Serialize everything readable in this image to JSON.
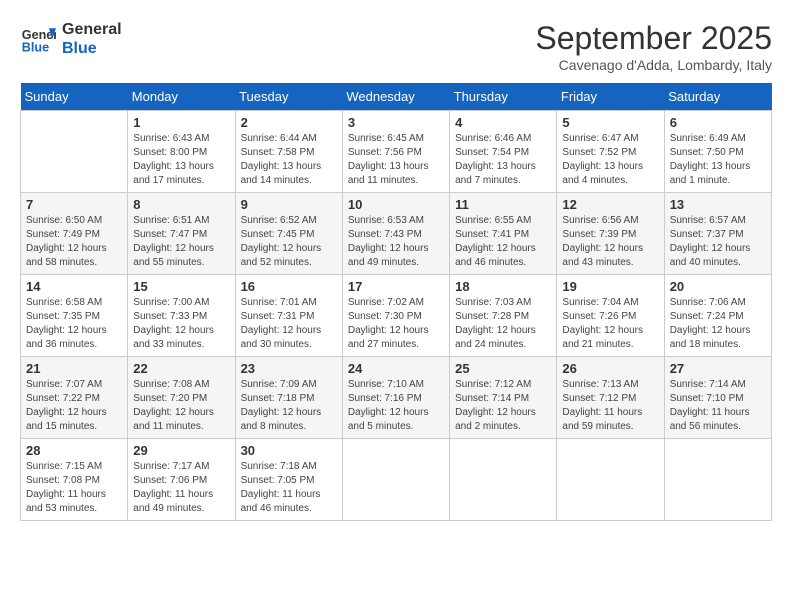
{
  "header": {
    "logo_line1": "General",
    "logo_line2": "Blue",
    "title": "September 2025",
    "subtitle": "Cavenago d'Adda, Lombardy, Italy"
  },
  "weekdays": [
    "Sunday",
    "Monday",
    "Tuesday",
    "Wednesday",
    "Thursday",
    "Friday",
    "Saturday"
  ],
  "weeks": [
    [
      {
        "day": "",
        "sunrise": "",
        "sunset": "",
        "daylight": ""
      },
      {
        "day": "1",
        "sunrise": "Sunrise: 6:43 AM",
        "sunset": "Sunset: 8:00 PM",
        "daylight": "Daylight: 13 hours and 17 minutes."
      },
      {
        "day": "2",
        "sunrise": "Sunrise: 6:44 AM",
        "sunset": "Sunset: 7:58 PM",
        "daylight": "Daylight: 13 hours and 14 minutes."
      },
      {
        "day": "3",
        "sunrise": "Sunrise: 6:45 AM",
        "sunset": "Sunset: 7:56 PM",
        "daylight": "Daylight: 13 hours and 11 minutes."
      },
      {
        "day": "4",
        "sunrise": "Sunrise: 6:46 AM",
        "sunset": "Sunset: 7:54 PM",
        "daylight": "Daylight: 13 hours and 7 minutes."
      },
      {
        "day": "5",
        "sunrise": "Sunrise: 6:47 AM",
        "sunset": "Sunset: 7:52 PM",
        "daylight": "Daylight: 13 hours and 4 minutes."
      },
      {
        "day": "6",
        "sunrise": "Sunrise: 6:49 AM",
        "sunset": "Sunset: 7:50 PM",
        "daylight": "Daylight: 13 hours and 1 minute."
      }
    ],
    [
      {
        "day": "7",
        "sunrise": "Sunrise: 6:50 AM",
        "sunset": "Sunset: 7:49 PM",
        "daylight": "Daylight: 12 hours and 58 minutes."
      },
      {
        "day": "8",
        "sunrise": "Sunrise: 6:51 AM",
        "sunset": "Sunset: 7:47 PM",
        "daylight": "Daylight: 12 hours and 55 minutes."
      },
      {
        "day": "9",
        "sunrise": "Sunrise: 6:52 AM",
        "sunset": "Sunset: 7:45 PM",
        "daylight": "Daylight: 12 hours and 52 minutes."
      },
      {
        "day": "10",
        "sunrise": "Sunrise: 6:53 AM",
        "sunset": "Sunset: 7:43 PM",
        "daylight": "Daylight: 12 hours and 49 minutes."
      },
      {
        "day": "11",
        "sunrise": "Sunrise: 6:55 AM",
        "sunset": "Sunset: 7:41 PM",
        "daylight": "Daylight: 12 hours and 46 minutes."
      },
      {
        "day": "12",
        "sunrise": "Sunrise: 6:56 AM",
        "sunset": "Sunset: 7:39 PM",
        "daylight": "Daylight: 12 hours and 43 minutes."
      },
      {
        "day": "13",
        "sunrise": "Sunrise: 6:57 AM",
        "sunset": "Sunset: 7:37 PM",
        "daylight": "Daylight: 12 hours and 40 minutes."
      }
    ],
    [
      {
        "day": "14",
        "sunrise": "Sunrise: 6:58 AM",
        "sunset": "Sunset: 7:35 PM",
        "daylight": "Daylight: 12 hours and 36 minutes."
      },
      {
        "day": "15",
        "sunrise": "Sunrise: 7:00 AM",
        "sunset": "Sunset: 7:33 PM",
        "daylight": "Daylight: 12 hours and 33 minutes."
      },
      {
        "day": "16",
        "sunrise": "Sunrise: 7:01 AM",
        "sunset": "Sunset: 7:31 PM",
        "daylight": "Daylight: 12 hours and 30 minutes."
      },
      {
        "day": "17",
        "sunrise": "Sunrise: 7:02 AM",
        "sunset": "Sunset: 7:30 PM",
        "daylight": "Daylight: 12 hours and 27 minutes."
      },
      {
        "day": "18",
        "sunrise": "Sunrise: 7:03 AM",
        "sunset": "Sunset: 7:28 PM",
        "daylight": "Daylight: 12 hours and 24 minutes."
      },
      {
        "day": "19",
        "sunrise": "Sunrise: 7:04 AM",
        "sunset": "Sunset: 7:26 PM",
        "daylight": "Daylight: 12 hours and 21 minutes."
      },
      {
        "day": "20",
        "sunrise": "Sunrise: 7:06 AM",
        "sunset": "Sunset: 7:24 PM",
        "daylight": "Daylight: 12 hours and 18 minutes."
      }
    ],
    [
      {
        "day": "21",
        "sunrise": "Sunrise: 7:07 AM",
        "sunset": "Sunset: 7:22 PM",
        "daylight": "Daylight: 12 hours and 15 minutes."
      },
      {
        "day": "22",
        "sunrise": "Sunrise: 7:08 AM",
        "sunset": "Sunset: 7:20 PM",
        "daylight": "Daylight: 12 hours and 11 minutes."
      },
      {
        "day": "23",
        "sunrise": "Sunrise: 7:09 AM",
        "sunset": "Sunset: 7:18 PM",
        "daylight": "Daylight: 12 hours and 8 minutes."
      },
      {
        "day": "24",
        "sunrise": "Sunrise: 7:10 AM",
        "sunset": "Sunset: 7:16 PM",
        "daylight": "Daylight: 12 hours and 5 minutes."
      },
      {
        "day": "25",
        "sunrise": "Sunrise: 7:12 AM",
        "sunset": "Sunset: 7:14 PM",
        "daylight": "Daylight: 12 hours and 2 minutes."
      },
      {
        "day": "26",
        "sunrise": "Sunrise: 7:13 AM",
        "sunset": "Sunset: 7:12 PM",
        "daylight": "Daylight: 11 hours and 59 minutes."
      },
      {
        "day": "27",
        "sunrise": "Sunrise: 7:14 AM",
        "sunset": "Sunset: 7:10 PM",
        "daylight": "Daylight: 11 hours and 56 minutes."
      }
    ],
    [
      {
        "day": "28",
        "sunrise": "Sunrise: 7:15 AM",
        "sunset": "Sunset: 7:08 PM",
        "daylight": "Daylight: 11 hours and 53 minutes."
      },
      {
        "day": "29",
        "sunrise": "Sunrise: 7:17 AM",
        "sunset": "Sunset: 7:06 PM",
        "daylight": "Daylight: 11 hours and 49 minutes."
      },
      {
        "day": "30",
        "sunrise": "Sunrise: 7:18 AM",
        "sunset": "Sunset: 7:05 PM",
        "daylight": "Daylight: 11 hours and 46 minutes."
      },
      {
        "day": "",
        "sunrise": "",
        "sunset": "",
        "daylight": ""
      },
      {
        "day": "",
        "sunrise": "",
        "sunset": "",
        "daylight": ""
      },
      {
        "day": "",
        "sunrise": "",
        "sunset": "",
        "daylight": ""
      },
      {
        "day": "",
        "sunrise": "",
        "sunset": "",
        "daylight": ""
      }
    ]
  ]
}
